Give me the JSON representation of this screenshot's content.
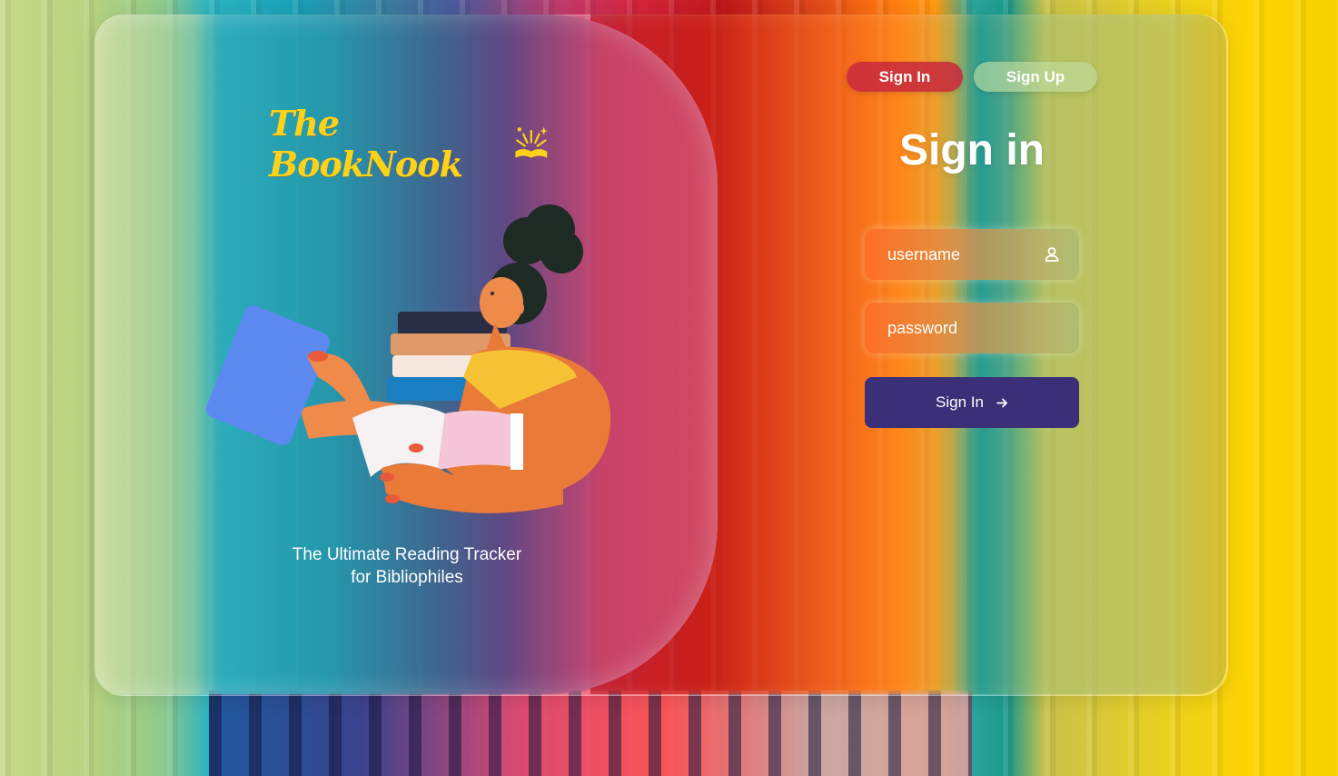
{
  "brand": {
    "name": "The BookNook",
    "tagline_line1": "The Ultimate Reading Tracker",
    "tagline_line2": "for Bibliophiles"
  },
  "tabs": [
    {
      "label": "Sign In",
      "active": true
    },
    {
      "label": "Sign Up",
      "active": false
    }
  ],
  "form": {
    "title": "Sign in",
    "username": {
      "placeholder": "username",
      "value": "",
      "icon": "user-icon"
    },
    "password": {
      "placeholder": "password",
      "value": ""
    },
    "submit_label": "Sign In",
    "submit_icon": "arrow-right-icon"
  },
  "colors": {
    "brand_yellow": "#ffd21a",
    "submit_bg": "#3b2f78",
    "active_tab": "#c8283c"
  }
}
